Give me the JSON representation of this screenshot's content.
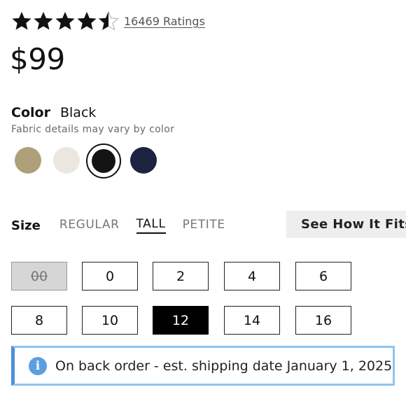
{
  "rating": {
    "stars_filled": 4.5,
    "stars_total": 5,
    "ratings_label": "16469 Ratings"
  },
  "price": "$99",
  "color": {
    "label": "Color",
    "selected": "Black",
    "note": "Fabric details may vary by color",
    "swatches": [
      {
        "name": "khaki",
        "hex": "#b0a07a"
      },
      {
        "name": "cream",
        "hex": "#ece6e0"
      },
      {
        "name": "black",
        "hex": "#141414"
      },
      {
        "name": "navy",
        "hex": "#1c2440"
      }
    ]
  },
  "size": {
    "label": "Size",
    "fits": [
      "REGULAR",
      "TALL",
      "PETITE"
    ],
    "active_fit": "TALL",
    "see_fits_label": "See How It Fits",
    "sizes": [
      {
        "label": "00",
        "state": "unavailable"
      },
      {
        "label": "0",
        "state": "available"
      },
      {
        "label": "2",
        "state": "available"
      },
      {
        "label": "4",
        "state": "available"
      },
      {
        "label": "6",
        "state": "available"
      },
      {
        "label": "8",
        "state": "available"
      },
      {
        "label": "10",
        "state": "available"
      },
      {
        "label": "12",
        "state": "selected"
      },
      {
        "label": "14",
        "state": "available"
      },
      {
        "label": "16",
        "state": "available"
      }
    ]
  },
  "notice": {
    "icon": "info-icon",
    "text": "On back order - est. shipping date January 1, 2025",
    "accent": "#4a90d9"
  }
}
